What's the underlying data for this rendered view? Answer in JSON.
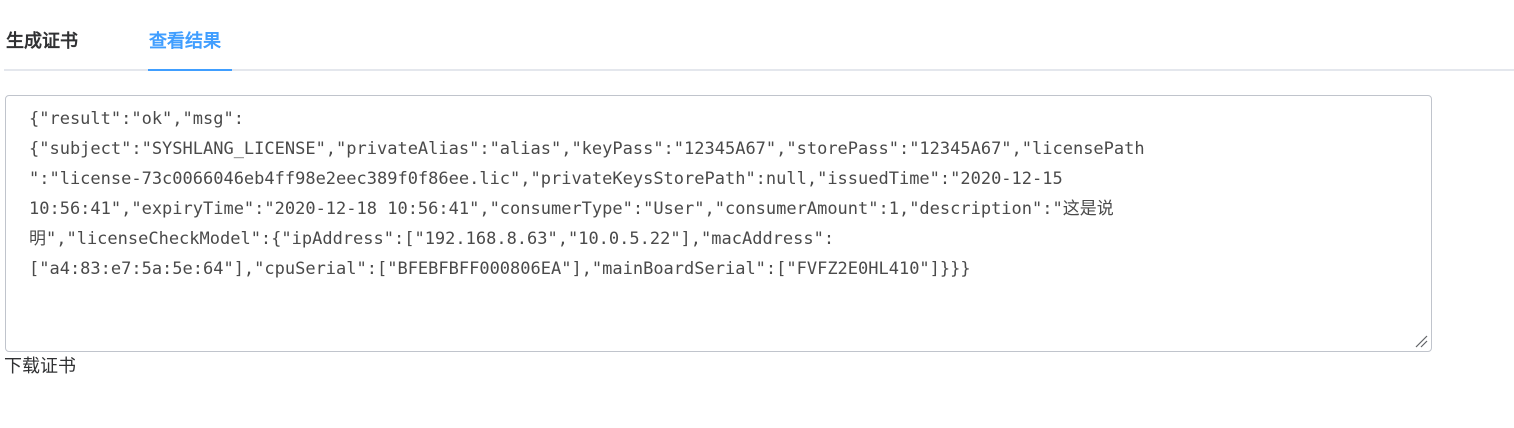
{
  "tabs": [
    {
      "label": "生成证书",
      "active": false
    },
    {
      "label": "查看结果",
      "active": true
    }
  ],
  "accent_color": "#409eff",
  "result": {
    "lines": [
      "{\"result\":\"ok\",\"msg\":",
      "{\"subject\":\"SYSHLANG_LICENSE\",\"privateAlias\":\"alias\",\"keyPass\":\"12345A67\",\"storePass\":\"12345A67\",\"licensePath",
      "\":\"license-73c0066046eb4ff98e2eec389f0f86ee.lic\",\"privateKeysStorePath\":null,\"issuedTime\":\"2020-12-15",
      "10:56:41\",\"expiryTime\":\"2020-12-18 10:56:41\",\"consumerType\":\"User\",\"consumerAmount\":1,\"description\":\"这是说",
      "明\",\"licenseCheckModel\":{\"ipAddress\":[\"192.168.8.63\",\"10.0.5.22\"],\"macAddress\":",
      "[\"a4:83:e7:5a:5e:64\"],\"cpuSerial\":[\"BFEBFBFF000806EA\"],\"mainBoardSerial\":[\"FVFZ2E0HL410\"]}}}"
    ]
  },
  "download_label": "下载证书"
}
